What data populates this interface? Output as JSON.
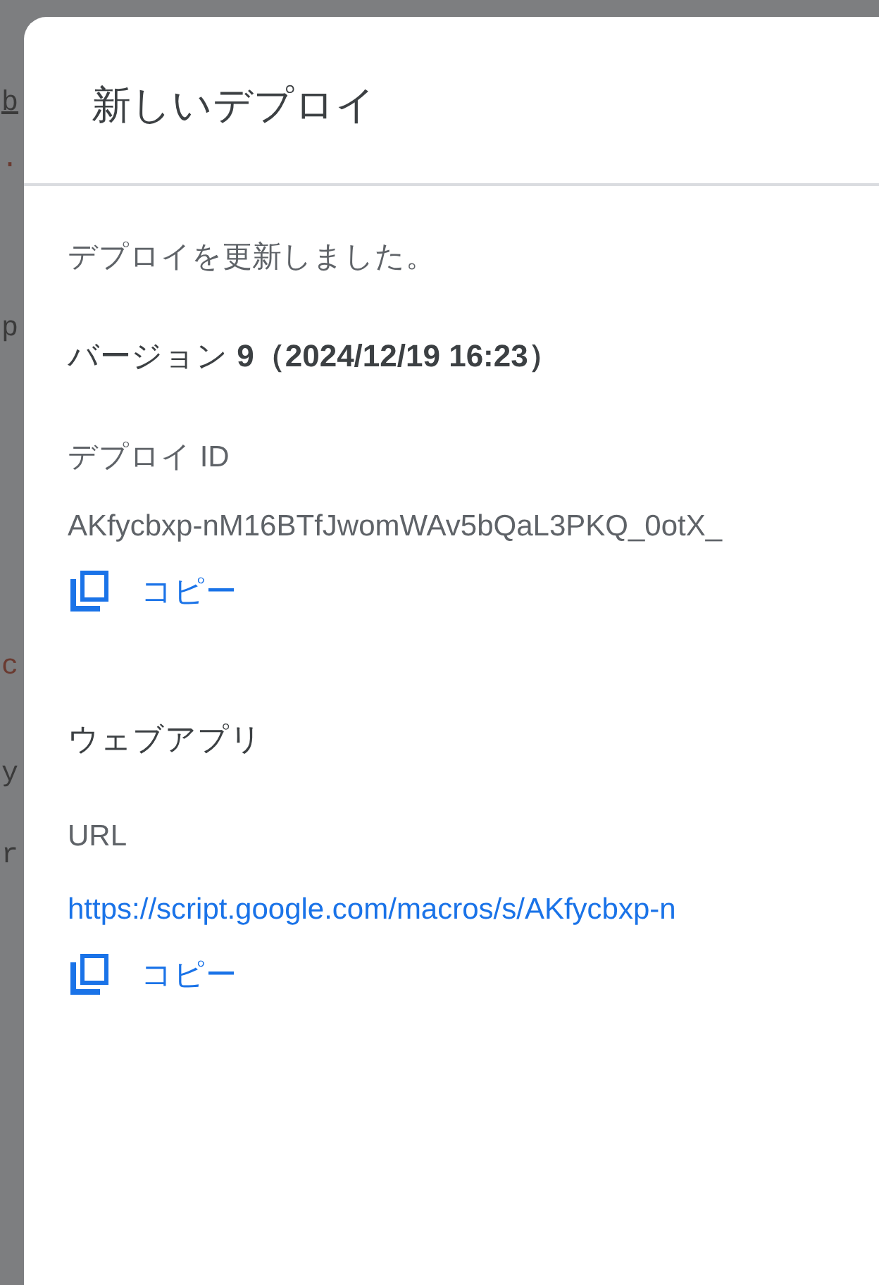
{
  "background_code": [
    {
      "text": "b",
      "kind": "link"
    },
    {
      "text": ".",
      "kind": "string"
    },
    {
      "text": "p",
      "kind": "call"
    },
    {
      "text": "c",
      "kind": "string"
    },
    {
      "text": "y",
      "kind": "call"
    },
    {
      "text": "r",
      "kind": "plain"
    }
  ],
  "dialog": {
    "title": "新しいデプロイ",
    "message": "デプロイを更新しました。",
    "version": "バージョン **9（2024/12/19 16:23）**",
    "deployment": {
      "label": "デプロイ ID",
      "value": "AKfycbxp-nM16BTfJwomWAv5bQaL3PKQ_0otX_",
      "copy": "コピー"
    },
    "web_app_heading": "ウェブアプリ",
    "web_app": {
      "label": "URL",
      "value": "https://script.google.com/macros/s/AKfycbxp-n",
      "copy": "コピー"
    }
  }
}
